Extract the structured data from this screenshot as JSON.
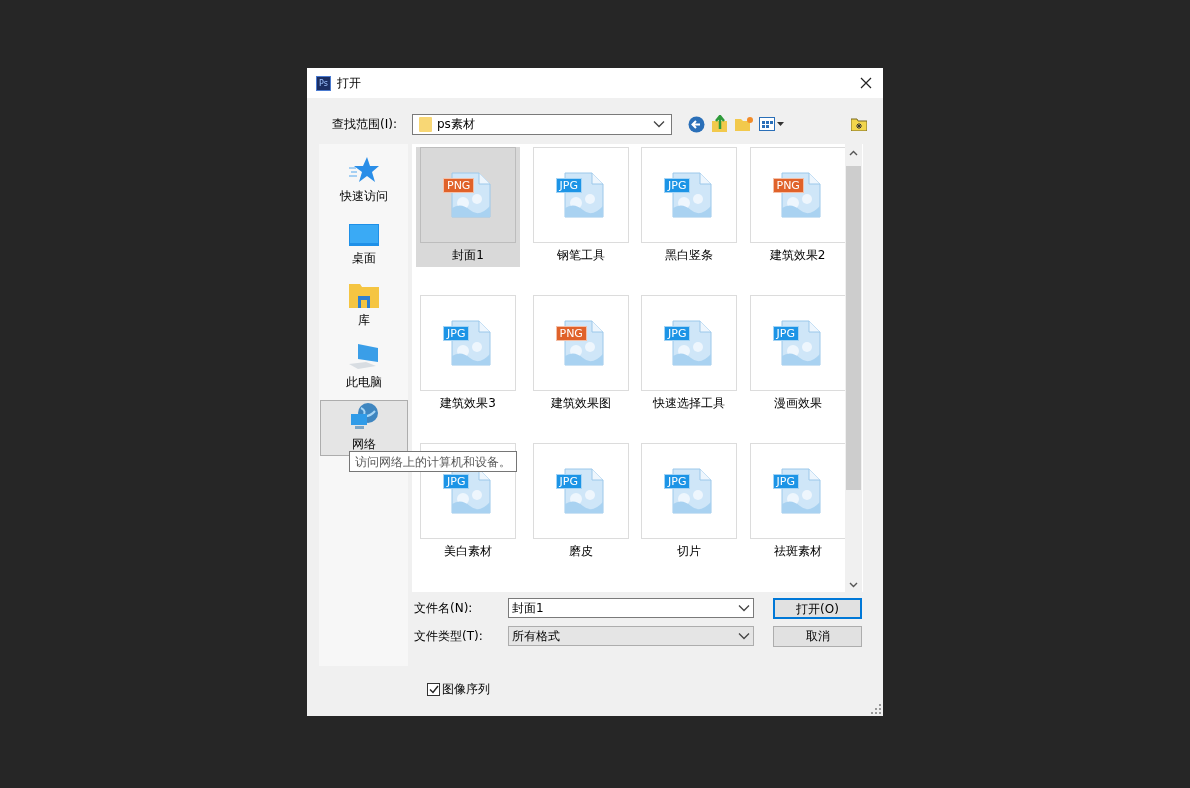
{
  "window": {
    "title": "打开",
    "app_badge": "Ps"
  },
  "look_in": {
    "label": "查找范围(I):",
    "value": "ps素材"
  },
  "sidebar": {
    "items": [
      {
        "kind": "quick",
        "label": "快速访问",
        "selected": false
      },
      {
        "kind": "desktop",
        "label": "桌面",
        "selected": false
      },
      {
        "kind": "library",
        "label": "库",
        "selected": false
      },
      {
        "kind": "pc",
        "label": "此电脑",
        "selected": false
      },
      {
        "kind": "network",
        "label": "网络",
        "selected": true
      }
    ]
  },
  "tooltip": "访问网络上的计算机和设备。",
  "files": [
    {
      "name": "封面1",
      "kind": "png",
      "badge": "PNG",
      "selected": true
    },
    {
      "name": "钢笔工具",
      "kind": "jpg",
      "badge": "JPG",
      "selected": false
    },
    {
      "name": "黑白竖条",
      "kind": "jpg",
      "badge": "JPG",
      "selected": false
    },
    {
      "name": "建筑效果2",
      "kind": "png",
      "badge": "PNG",
      "selected": false
    },
    {
      "name": "建筑效果3",
      "kind": "jpg",
      "badge": "JPG",
      "selected": false
    },
    {
      "name": "建筑效果图",
      "kind": "png",
      "badge": "PNG",
      "selected": false
    },
    {
      "name": "快速选择工具",
      "kind": "jpg",
      "badge": "JPG",
      "selected": false
    },
    {
      "name": "漫画效果",
      "kind": "jpg",
      "badge": "JPG",
      "selected": false
    },
    {
      "name": "美白素材",
      "kind": "jpg",
      "badge": "JPG",
      "selected": false
    },
    {
      "name": "磨皮",
      "kind": "jpg",
      "badge": "JPG",
      "selected": false
    },
    {
      "name": "切片",
      "kind": "jpg",
      "badge": "JPG",
      "selected": false
    },
    {
      "name": "祛斑素材",
      "kind": "jpg",
      "badge": "JPG",
      "selected": false
    }
  ],
  "file_name": {
    "label": "文件名(N):",
    "value": "封面1"
  },
  "file_type": {
    "label": "文件类型(T):",
    "value": "所有格式"
  },
  "buttons": [
    {
      "label": "打开(O)",
      "kind": "primary"
    },
    {
      "label": "取消",
      "kind": "normal"
    }
  ],
  "image_sequence": {
    "label": "图像序列",
    "checked": true
  }
}
